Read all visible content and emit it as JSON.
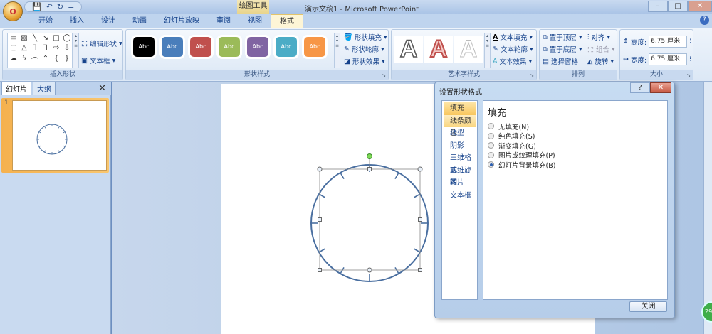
{
  "window": {
    "title": "演示文稿1 - Microsoft PowerPoint",
    "context_tab": "绘图工具",
    "buttons": {
      "minimize": "–",
      "restore": "□",
      "close": "✕"
    }
  },
  "qat": {
    "save": "💾",
    "undo": "↶",
    "redo": "↻",
    "more": "="
  },
  "office_button": "O",
  "tabs": [
    "开始",
    "插入",
    "设计",
    "动画",
    "幻灯片放映",
    "审阅",
    "视图",
    "格式"
  ],
  "active_tab": "格式",
  "help": "?",
  "ribbon": {
    "insert_shapes": {
      "label": "插入形状",
      "edit_shape": "编辑形状",
      "text_box": "文本框",
      "shapes": [
        "▭",
        "▨",
        "╲",
        "↘",
        "□",
        "◯",
        "▢",
        "△",
        "⅂",
        "⅂",
        "⇨",
        "⇩",
        "☁",
        "ϟ",
        "⌒",
        "⌃",
        "{",
        "}"
      ]
    },
    "shape_styles": {
      "label": "形状样式",
      "swatches": [
        {
          "text": "Abc",
          "color": "#000000"
        },
        {
          "text": "Abc",
          "color": "#4a7ebb"
        },
        {
          "text": "Abc",
          "color": "#c0504d"
        },
        {
          "text": "Abc",
          "color": "#9bbb59"
        },
        {
          "text": "Abc",
          "color": "#8064a2"
        },
        {
          "text": "Abc",
          "color": "#4bacc6"
        },
        {
          "text": "Abc",
          "color": "#f79646"
        }
      ],
      "fill": "形状填充",
      "outline": "形状轮廓",
      "effects": "形状效果"
    },
    "wordart": {
      "label": "艺术字样式",
      "letters": [
        "A",
        "A",
        "A"
      ],
      "text_fill": "文本填充",
      "text_outline": "文本轮廓",
      "text_effects": "文本效果"
    },
    "arrange": {
      "label": "排列",
      "bring_front": "置于顶层",
      "send_back": "置于底层",
      "selection_pane": "选择窗格",
      "align": "对齐",
      "group": "组合",
      "rotate": "旋转"
    },
    "size": {
      "label": "大小",
      "height_label": "高度:",
      "height": "6.75 厘米",
      "width_label": "宽度:",
      "width": "6.75 厘米"
    }
  },
  "left_pane": {
    "tabs": [
      "幻灯片",
      "大纲"
    ],
    "close": "✕",
    "slide_number": "1"
  },
  "dialog": {
    "title": "设置形状格式",
    "help": "?",
    "close": "✕",
    "nav": [
      "填充",
      "线条颜色",
      "线型",
      "阴影",
      "三维格式",
      "三维旋转",
      "图片",
      "文本框"
    ],
    "selected_nav": "填充",
    "heading": "填充",
    "options": [
      {
        "label": "无填充(N)",
        "checked": false
      },
      {
        "label": "纯色填充(S)",
        "checked": false
      },
      {
        "label": "渐变填充(G)",
        "checked": false
      },
      {
        "label": "图片或纹理填充(P)",
        "checked": false
      },
      {
        "label": "幻灯片背景填充(B)",
        "checked": true
      }
    ],
    "close_button": "关闭"
  },
  "badge": "29",
  "colors": {
    "circle": "#4a6fa0",
    "accent": "#f8c65d"
  }
}
